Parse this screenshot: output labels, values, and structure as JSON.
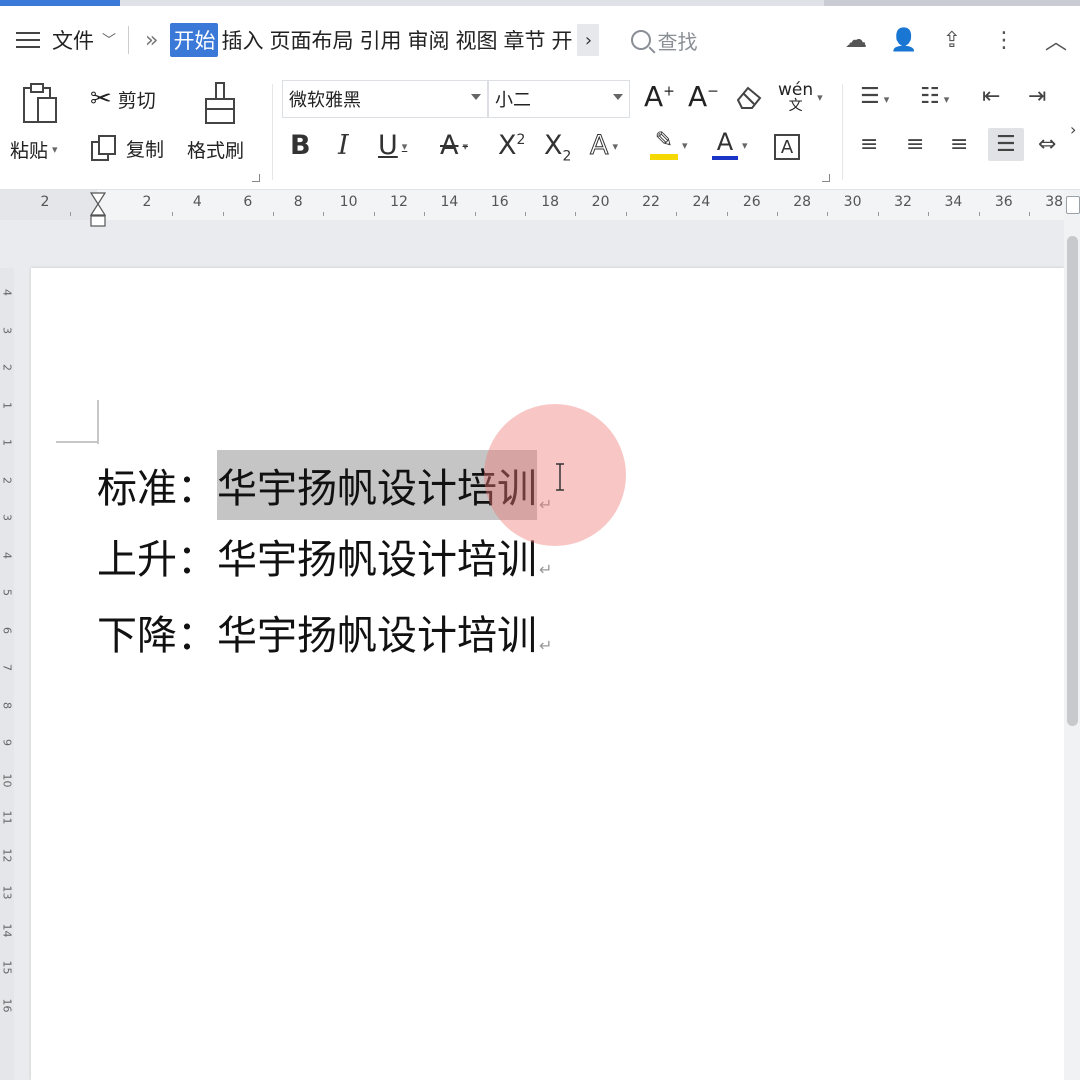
{
  "menubar": {
    "file_label": "文件",
    "tabs": [
      {
        "label": "开始",
        "active": true
      },
      {
        "label": "插入"
      },
      {
        "label": "页面布局"
      },
      {
        "label": "引用"
      },
      {
        "label": "审阅"
      },
      {
        "label": "视图"
      },
      {
        "label": "章节"
      },
      {
        "label": "开"
      }
    ],
    "search_label": "查找"
  },
  "ribbon": {
    "paste_label": "粘贴",
    "cut_label": "剪切",
    "copy_label": "复制",
    "format_painter_label": "格式刷",
    "font_name": "微软雅黑",
    "font_size": "小二",
    "pinyin_label": "wén"
  },
  "ruler": {
    "numbers": [
      "2",
      "2",
      "4",
      "6",
      "8",
      "10",
      "12",
      "14",
      "16",
      "18",
      "20",
      "22",
      "24",
      "26",
      "28",
      "30",
      "32",
      "34",
      "36",
      "38"
    ]
  },
  "vruler": {
    "numbers": [
      "4",
      "3",
      "2",
      "1",
      "1",
      "2",
      "3",
      "4",
      "5",
      "6",
      "7",
      "8",
      "9",
      "10",
      "11",
      "12",
      "13",
      "14",
      "15",
      "16"
    ]
  },
  "document": {
    "lines": [
      {
        "label": "标准：",
        "text": "华宇扬帆设计培训",
        "selected": true
      },
      {
        "label": "上升：",
        "text": "华宇扬帆设计培训",
        "selected": false
      },
      {
        "label": "下降：",
        "text": "华宇扬帆设计培训",
        "selected": false
      }
    ],
    "paragraph_mark": "↵"
  },
  "colors": {
    "accent": "#3b79d8",
    "highlight_yellow": "#f5d800",
    "font_color_blue": "#1a34c8",
    "selection_gray": "#c5c5c5",
    "click_halo": "#f07878"
  }
}
